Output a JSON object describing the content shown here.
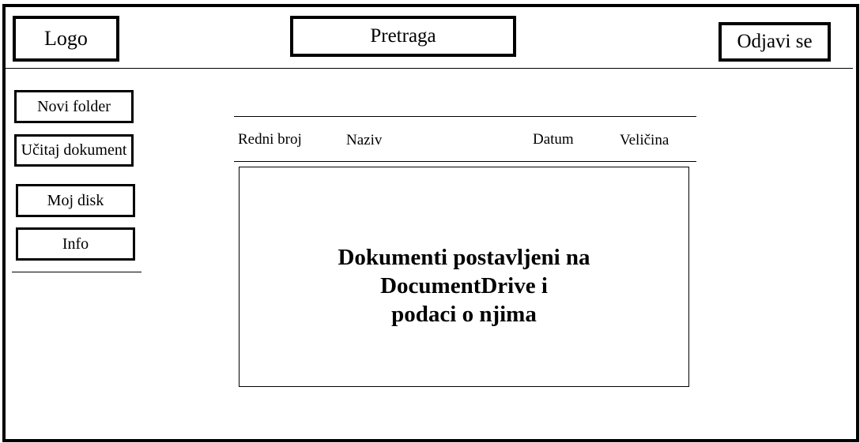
{
  "header": {
    "logo": "Logo",
    "search": "Pretraga",
    "logout": "Odjavi se"
  },
  "sidebar": {
    "items": [
      {
        "label": "Novi folder"
      },
      {
        "label": "Učitaj dokument"
      },
      {
        "label": "Moj disk"
      },
      {
        "label": "Info"
      }
    ]
  },
  "table": {
    "columns": [
      "Redni broj",
      "Naziv",
      "Datum",
      "Veličina"
    ]
  },
  "content": {
    "lines": [
      "Dokumenti postavljeni na",
      "DocumentDrive i",
      "podaci o njima"
    ]
  }
}
